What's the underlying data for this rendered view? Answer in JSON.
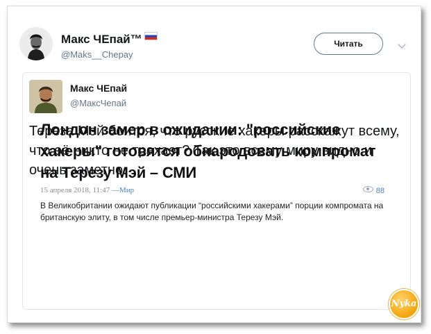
{
  "tweet": {
    "author_name": "Макс ЧЕпай™",
    "author_handle": "@Maks__Chepay",
    "follow_label": "Читать"
  },
  "quoted": {
    "author_name": "Макс ЧЕпай",
    "author_handle": "@МаксЧепай",
    "text": "Тереза Мэй боится, что русские хакеры расскажут всему, что её никто не трахает? Так это всему миру видно и очень заметно."
  },
  "article": {
    "headline": "Лондон замер в ожидании: \"российские хакеры\" готовятся обнародовать компромат на Терезу Мэй – СМИ",
    "date": "15 апреля 2018, 11:47",
    "category": "—Мир",
    "views": "88",
    "lead": "В Великобритании ожидают публикации “российскими хакерами” порции компромата на британскую элиту, в том числе премьер-министра Терезу Мэй."
  },
  "watermark": {
    "text": "Nyka"
  },
  "icons": {
    "flag": "russia-flag-icon",
    "menu": "chevron-down-icon",
    "views": "eye-icon"
  },
  "colors": {
    "text": "#14171a",
    "secondary": "#657786",
    "link": "#4a7fc1",
    "watermark": "#f5a30a"
  }
}
